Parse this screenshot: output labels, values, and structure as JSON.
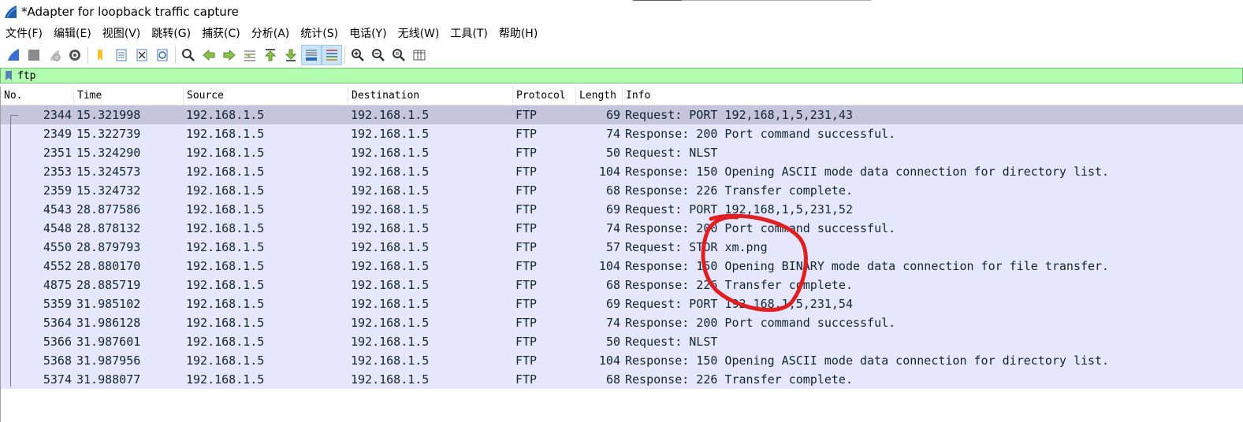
{
  "window": {
    "title": "*Adapter for loopback traffic capture"
  },
  "menu": [
    "文件(F)",
    "编辑(E)",
    "视图(V)",
    "跳转(G)",
    "捕获(C)",
    "分析(A)",
    "统计(S)",
    "电话(Y)",
    "无线(W)",
    "工具(T)",
    "帮助(H)"
  ],
  "toolbar_icons": [
    "shark-fin-start-icon",
    "stop-capture-icon",
    "restart-capture-icon",
    "capture-options-icon",
    "open-file-icon",
    "save-file-icon",
    "close-file-icon",
    "reload-file-icon",
    "find-packet-icon",
    "go-back-icon",
    "go-forward-icon",
    "go-to-packet-icon",
    "first-packet-icon",
    "last-packet-icon",
    "autoscroll-icon",
    "colorize-icon",
    "zoom-in-icon",
    "zoom-out-icon",
    "zoom-normal-icon",
    "resize-columns-icon"
  ],
  "filter": {
    "text": "ftp",
    "bg_color": "#afffaf"
  },
  "columns": [
    "No.",
    "Time",
    "Source",
    "Destination",
    "Protocol",
    "Length",
    "Info"
  ],
  "row_color": "#e7e6ff",
  "selected_row_color": "#c6c5dd",
  "packets": [
    {
      "no": "2344",
      "time": "15.321998",
      "src": "192.168.1.5",
      "dst": "192.168.1.5",
      "proto": "FTP",
      "len": "69",
      "info": "Request: PORT 192,168,1,5,231,43",
      "selected": true
    },
    {
      "no": "2349",
      "time": "15.322739",
      "src": "192.168.1.5",
      "dst": "192.168.1.5",
      "proto": "FTP",
      "len": "74",
      "info": "Response: 200 Port command successful."
    },
    {
      "no": "2351",
      "time": "15.324290",
      "src": "192.168.1.5",
      "dst": "192.168.1.5",
      "proto": "FTP",
      "len": "50",
      "info": "Request: NLST"
    },
    {
      "no": "2353",
      "time": "15.324573",
      "src": "192.168.1.5",
      "dst": "192.168.1.5",
      "proto": "FTP",
      "len": "104",
      "info": "Response: 150 Opening ASCII mode data connection for directory list."
    },
    {
      "no": "2359",
      "time": "15.324732",
      "src": "192.168.1.5",
      "dst": "192.168.1.5",
      "proto": "FTP",
      "len": "68",
      "info": "Response: 226 Transfer complete."
    },
    {
      "no": "4543",
      "time": "28.877586",
      "src": "192.168.1.5",
      "dst": "192.168.1.5",
      "proto": "FTP",
      "len": "69",
      "info": "Request: PORT 192,168,1,5,231,52"
    },
    {
      "no": "4548",
      "time": "28.878132",
      "src": "192.168.1.5",
      "dst": "192.168.1.5",
      "proto": "FTP",
      "len": "74",
      "info": "Response: 200 Port command successful."
    },
    {
      "no": "4550",
      "time": "28.879793",
      "src": "192.168.1.5",
      "dst": "192.168.1.5",
      "proto": "FTP",
      "len": "57",
      "info": "Request: STOR xm.png"
    },
    {
      "no": "4552",
      "time": "28.880170",
      "src": "192.168.1.5",
      "dst": "192.168.1.5",
      "proto": "FTP",
      "len": "104",
      "info": "Response: 150 Opening BINARY mode data connection for file transfer."
    },
    {
      "no": "4875",
      "time": "28.885719",
      "src": "192.168.1.5",
      "dst": "192.168.1.5",
      "proto": "FTP",
      "len": "68",
      "info": "Response: 226 Transfer complete."
    },
    {
      "no": "5359",
      "time": "31.985102",
      "src": "192.168.1.5",
      "dst": "192.168.1.5",
      "proto": "FTP",
      "len": "69",
      "info": "Request: PORT 192,168,1,5,231,54"
    },
    {
      "no": "5364",
      "time": "31.986128",
      "src": "192.168.1.5",
      "dst": "192.168.1.5",
      "proto": "FTP",
      "len": "74",
      "info": "Response: 200 Port command successful."
    },
    {
      "no": "5366",
      "time": "31.987601",
      "src": "192.168.1.5",
      "dst": "192.168.1.5",
      "proto": "FTP",
      "len": "50",
      "info": "Request: NLST"
    },
    {
      "no": "5368",
      "time": "31.987956",
      "src": "192.168.1.5",
      "dst": "192.168.1.5",
      "proto": "FTP",
      "len": "104",
      "info": "Response: 150 Opening ASCII mode data connection for directory list."
    },
    {
      "no": "5374",
      "time": "31.988077",
      "src": "192.168.1.5",
      "dst": "192.168.1.5",
      "proto": "FTP",
      "len": "68",
      "info": "Response: 226 Transfer complete."
    }
  ],
  "annotation_color": "#e02020"
}
